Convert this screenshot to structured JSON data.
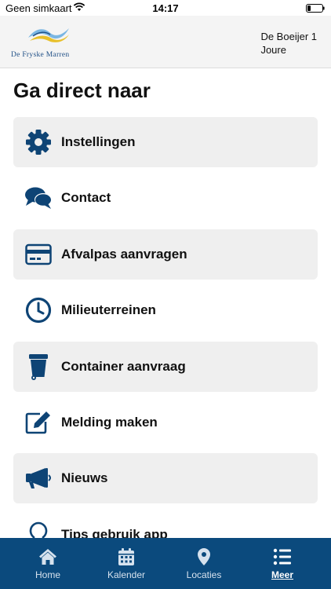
{
  "status_bar": {
    "carrier": "Geen simkaart",
    "time": "14:17"
  },
  "header": {
    "logo_text": "De Fryske Marren",
    "address_line1": "De Boeijer 1",
    "address_line2": "Joure"
  },
  "page": {
    "title": "Ga direct naar"
  },
  "menu": {
    "items": [
      {
        "label": "Instellingen",
        "icon": "gear-icon"
      },
      {
        "label": "Contact",
        "icon": "chat-bubbles-icon"
      },
      {
        "label": "Afvalpas aanvragen",
        "icon": "credit-card-icon"
      },
      {
        "label": "Milieuterreinen",
        "icon": "clock-icon"
      },
      {
        "label": "Container aanvraag",
        "icon": "trash-bin-icon"
      },
      {
        "label": "Melding maken",
        "icon": "edit-icon"
      },
      {
        "label": "Nieuws",
        "icon": "megaphone-icon"
      },
      {
        "label": "Tips gebruik app",
        "icon": "lightbulb-icon"
      }
    ]
  },
  "tabbar": {
    "tabs": [
      {
        "label": "Home",
        "icon": "home-icon",
        "active": false
      },
      {
        "label": "Kalender",
        "icon": "calendar-icon",
        "active": false
      },
      {
        "label": "Locaties",
        "icon": "map-pin-icon",
        "active": false
      },
      {
        "label": "Meer",
        "icon": "list-icon",
        "active": true
      }
    ]
  },
  "colors": {
    "brand_blue": "#0b4a7d",
    "icon_blue": "#0e4475",
    "shaded_row": "#efefef",
    "header_bg": "#f4f4f4"
  }
}
